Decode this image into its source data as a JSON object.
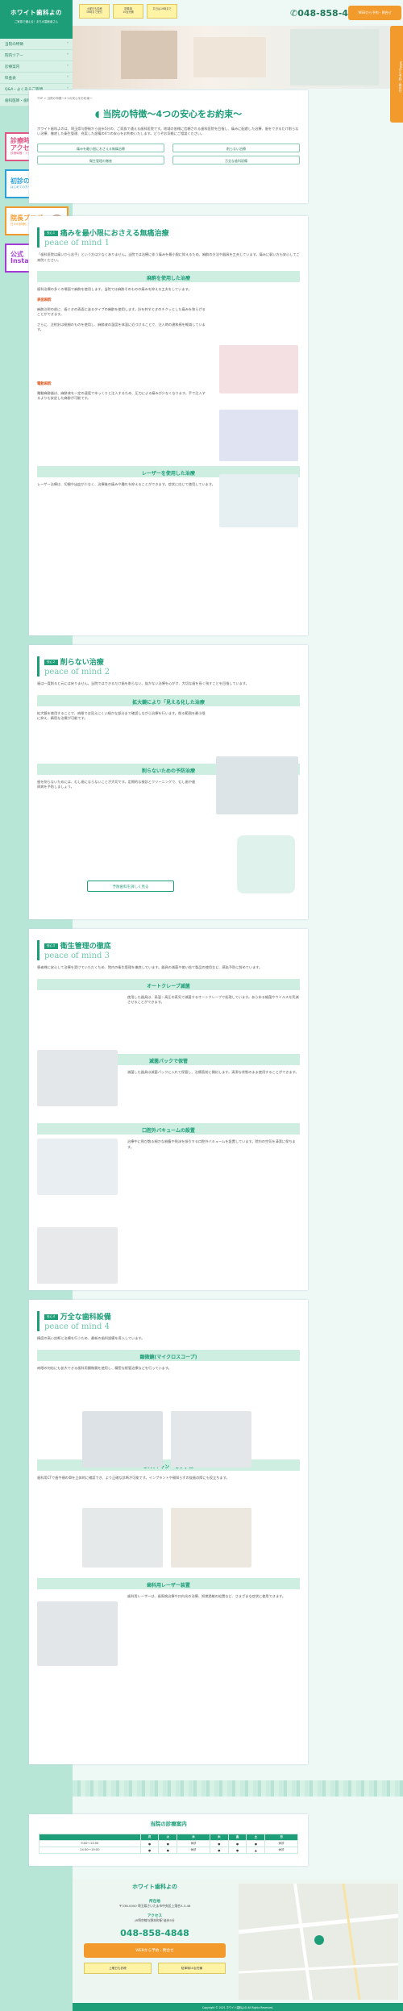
{
  "sidebar": {
    "logo": "ホワイト歯科よの",
    "sub": "ご家族で通える！まちの歯医者さん",
    "nav": [
      "当院の特徴",
      "院内ツアー",
      "診療案内",
      "料金表",
      "Q&A・よくあるご質問",
      "歯科医師・歯科衛生士を募集中"
    ],
    "banners": [
      {
        "main": "診療時間\nアクセス",
        "sub": "診療時間・アクセス案内",
        "color": "#e05583"
      },
      {
        "main": "初診の方へ",
        "sub": "はじめての方への歯科ガイド",
        "color": "#2aa0d8"
      },
      {
        "main": "院長ブログ",
        "sub": "日々の診療について",
        "color": "#f39a2c"
      },
      {
        "main": "公式\nInstagram",
        "sub": "",
        "color": "#a43bd6"
      }
    ]
  },
  "header": {
    "b1": "土曜日も診療\n16時まで受付",
    "b2": "駐車場\n10台完備",
    "b3": "平日は19時まで",
    "tel": "048-858-4848",
    "cta": "WEBから予約・問合せ",
    "side_cta": "WEBから予約・問合せ"
  },
  "intro": {
    "crumb": "TOP > 当院の特徴～4つの安心をお約束～",
    "title": "当院の特徴～4つの安心をお約束～",
    "text": "ホワイト歯科よのは、埼玉県与野駅から徒歩5分の、ご家族で通える歯科医院です。地域の皆様に信頼される歯科医院を目指し、痛みに配慮した治療、歯をできるだけ削らない治療、徹底した衛生管理、充実した設備の4つの安心をお約束いたします。どうぞお気軽にご相談ください。",
    "anchors": [
      "痛みを最小限におさえる無痛治療",
      "削らない治療",
      "衛生管理の徹底",
      "万全な歯科設備"
    ]
  },
  "s1": {
    "tag": "安心１",
    "title": "痛みを最小限におさえる無痛治療",
    "en": "peace of mind 1",
    "text": "「歯科医院は痛いから苦手」という方は少なくありません。当院では治療に伴う痛みを最小限に抑えるため、麻酔の方法や器具を工夫しています。痛みに弱い方も安心してご来院ください。",
    "h1": "麻酔を使用した治療",
    "t1": "歯科治療の多くの場面で麻酔を使用します。当院では麻酔そのものの痛みを抑える工夫をしています。",
    "l1": "表面麻酔",
    "p1": "麻酔注射の前に、歯ぐきの表面に塗るタイプの麻酔を使用します。針を刺すときのチクッとした痛みを和らげることができます。",
    "p2": "さらに、注射針は極細のものを使用し、麻酔液の温度を体温に近づけることで、注入時の違和感を軽減しています。",
    "l2": "電動麻酔",
    "p3": "電動麻酔器は、麻酔液を一定の速度でゆっくりと注入するため、圧力による痛みが少なくなります。手で注入するよりも安定した麻酔が可能です。",
    "h2": "レーザーを使用した治療",
    "t2": "レーザー治療は、切開や出血が少なく、治療後の痛みや腫れを抑えることができます。症状に応じて使用しています。"
  },
  "s2": {
    "tag": "安心２",
    "title": "削らない治療",
    "en": "peace of mind 2",
    "text": "歯は一度削ると元には戻りません。当院ではできるだけ歯を削らない、抜かない治療を心がけ、大切な歯を長く残すことを目指しています。",
    "h1": "拡大鏡により「見える化した治療",
    "t1": "拡大鏡を使用することで、肉眼では見えにくい細かな部分まで確認しながら治療を行います。削る範囲を最小限に抑え、精密な治療が可能です。",
    "h2": "削らないための予防治療",
    "t2": "歯を削らないためには、むし歯にならないことが大切です。定期的な検診とクリーニングで、むし歯や歯周病を予防しましょう。",
    "btn": "予防歯科を詳しく見る"
  },
  "s3": {
    "tag": "安心３",
    "title": "衛生管理の徹底",
    "en": "peace of mind 3",
    "text": "患者様に安心して治療を受けていただくため、院内の衛生管理を徹底しています。器具の滅菌や使い捨て製品の使用など、感染予防に努めています。",
    "h1": "オートクレーブ滅菌",
    "t1": "使用した器具は、高温・高圧の蒸気で滅菌するオートクレーブで処理しています。あらゆる細菌やウイルスを死滅させることができます。",
    "h2": "滅菌パックで保管",
    "t2": "滅菌した器具は滅菌パックに入れて保管し、治療直前に開封します。清潔な状態のまま使用することができます。",
    "h3": "口腔外バキュームの設置",
    "t3": "治療中に飛び散る細かな粉塵や飛沫を吸引する口腔外バキュームを設置しています。院内の空気を清潔に保ちます。"
  },
  "s4": {
    "tag": "安心４",
    "title": "万全な歯科設備",
    "en": "peace of mind 4",
    "text": "精度の高い診断と治療を行うため、最新の歯科設備を導入しています。",
    "h1": "顕微鏡(マイクロスコープ)",
    "t1": "肉眼の何倍にも拡大できる歯科用顕微鏡を使用し、精密な根管治療などを行っています。",
    "h2": "CTスキャン・セファロ",
    "t2": "歯科用CTで歯や顎の骨を立体的に確認でき、より正確な診断が可能です。インプラントや親知らずの抜歯の際にも役立ちます。",
    "h3": "歯科用レーザー装置",
    "t3": "歯科用レーザーは、歯周病治療や口内炎の治療、知覚過敏の処置など、さまざまな症状に使用できます。"
  },
  "hours": {
    "title": "当院の診療案内",
    "head": [
      "",
      "月",
      "火",
      "水",
      "木",
      "金",
      "土",
      "日"
    ],
    "rows": [
      [
        "9:00～13:00",
        "●",
        "●",
        "休診",
        "●",
        "●",
        "●",
        "休診"
      ],
      [
        "14:30～19:00",
        "●",
        "●",
        "休診",
        "●",
        "●",
        "▲",
        "休診"
      ]
    ]
  },
  "footer": {
    "name": "ホワイト歯科よの",
    "addr_h": "所在地",
    "addr": "〒338-0000 埼玉県さいたま市中央区上落合3-3-46",
    "acc_h": "アクセス",
    "acc": "JR埼京線与野本町駅 徒歩5分",
    "tel": "048-858-4848",
    "cta": "WEBから予約・問合せ",
    "b1": "土曜日も診療",
    "b2": "駐車場10台完備",
    "copy": "Copyright © 2021 ホワイト歯科よの All Rights Reserved."
  }
}
